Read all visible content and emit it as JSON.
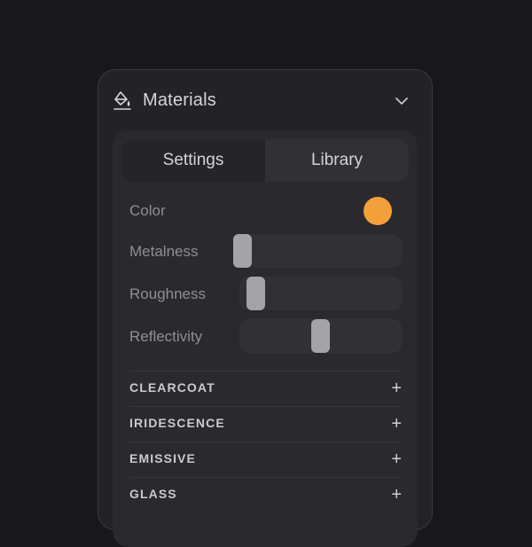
{
  "header": {
    "title": "Materials",
    "icon": "paint-bucket-icon",
    "collapse_icon": "chevron-down-icon"
  },
  "tabs": [
    {
      "label": "Settings",
      "active": true
    },
    {
      "label": "Library",
      "active": false
    }
  ],
  "properties": {
    "color": {
      "label": "Color",
      "value": "#f4a03a"
    },
    "metalness": {
      "label": "Metalness",
      "value": 0.0
    },
    "roughness": {
      "label": "Roughness",
      "value": 0.05
    },
    "reflectivity": {
      "label": "Reflectivity",
      "value": 0.5
    }
  },
  "sections": [
    {
      "label": "CLEARCOAT",
      "icon": "plus-icon"
    },
    {
      "label": "IRIDESCENCE",
      "icon": "plus-icon"
    },
    {
      "label": "EMISSIVE",
      "icon": "plus-icon"
    },
    {
      "label": "GLASS",
      "icon": "plus-icon"
    }
  ],
  "colors": {
    "background": "#18181a",
    "panel": "#232326",
    "card": "#2a2a2e",
    "accent_swatch": "#f4a03a",
    "thumb": "#a3a3aa"
  }
}
